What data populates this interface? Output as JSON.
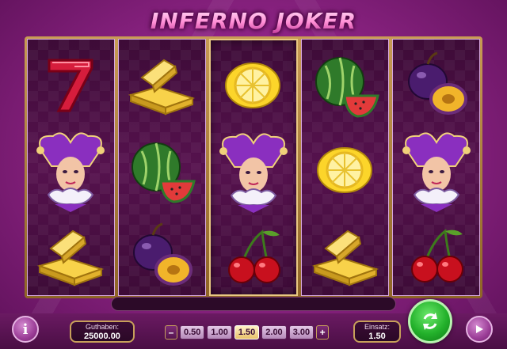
{
  "game": {
    "title": "INFERNO JOKER"
  },
  "reels": [
    [
      "seven-icon",
      "joker-icon",
      "gold-bars-icon"
    ],
    [
      "gold-bars-icon",
      "watermelon-icon",
      "plum-icon"
    ],
    [
      "lemon-icon",
      "joker-icon",
      "cherries-icon"
    ],
    [
      "watermelon-icon",
      "lemon-icon",
      "gold-bars-icon"
    ],
    [
      "plum-icon",
      "joker-icon",
      "cherries-icon"
    ]
  ],
  "controls": {
    "info_label": "i",
    "balance_label": "Guthaben:",
    "balance_value": "25000.00",
    "stake_label": "Einsatz:",
    "stake_value": "1.50",
    "minus_label": "–",
    "plus_label": "+",
    "bet_options": [
      "0.50",
      "1.00",
      "1.50",
      "2.00",
      "3.00"
    ],
    "selected_bet": "1.50"
  },
  "colors": {
    "background": "#8e2485",
    "reel_bg": "#4a0f44",
    "frame_gold": "#c89b54",
    "spin_green": "#23b12b"
  }
}
